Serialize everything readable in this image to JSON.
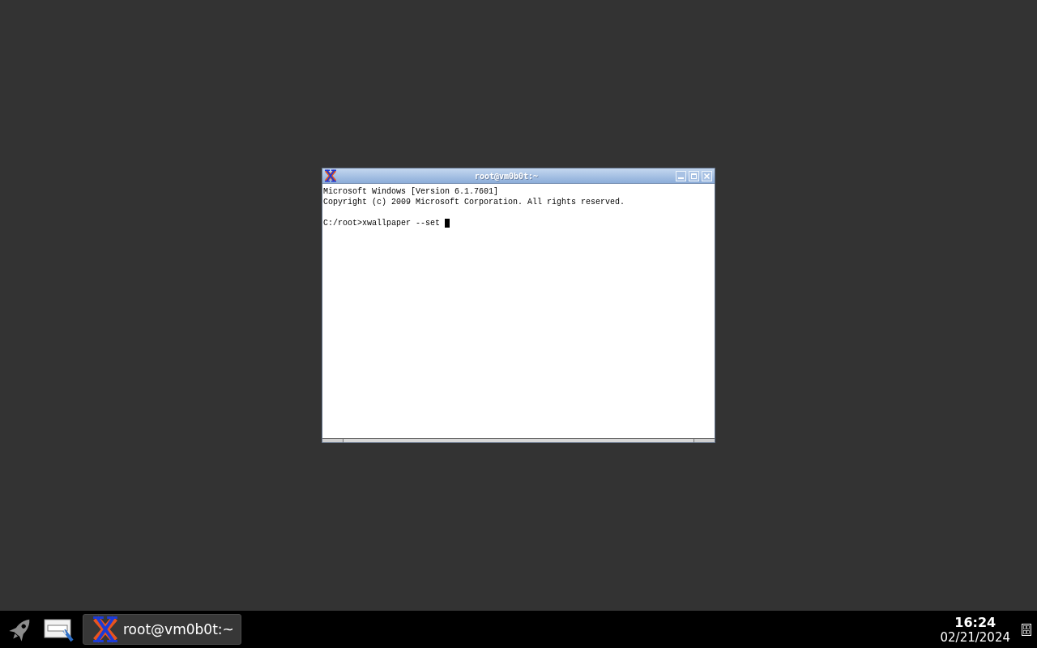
{
  "terminal_window": {
    "title": "root@vm0b0t:~",
    "output_lines": [
      "Microsoft Windows [Version 6.1.7601]",
      "Copyright (c) 2009 Microsoft Corporation. All rights reserved."
    ],
    "input_line": "C:/root>xwallpaper --set"
  },
  "taskbar": {
    "tasks": [
      {
        "label": "root@vm0b0t:~",
        "selected": true
      }
    ],
    "clock": {
      "time": "16:24",
      "date": "02/21/2024"
    }
  }
}
